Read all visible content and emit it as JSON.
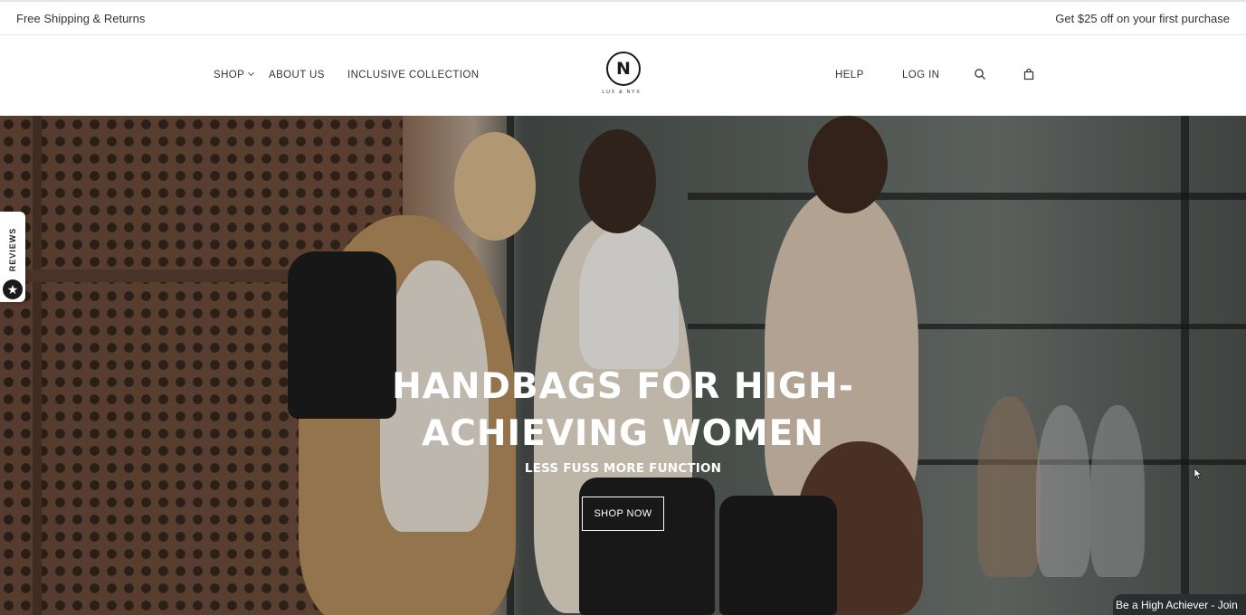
{
  "announcement": {
    "left": "Free Shipping & Returns",
    "right": "Get $25 off on your first purchase"
  },
  "nav": {
    "left_links": [
      "SHOP",
      "ABOUT US",
      "INCLUSIVE COLLECTION"
    ],
    "right_links": [
      "HELP",
      "LOG IN"
    ],
    "logo_mark": "N",
    "logo_text": "LUX & NYX",
    "icons": [
      "search-icon",
      "bag-icon",
      "chevron-down-icon"
    ]
  },
  "hero": {
    "title_line1": "HANDBAGS FOR HIGH-",
    "title_line2": "ACHIEVING WOMEN",
    "subtitle": "LESS FUSS MORE FUNCTION",
    "cta": "SHOP NOW"
  },
  "reviews_tab": {
    "label": "REVIEWS",
    "icon": "star-icon"
  },
  "rewards_badge": {
    "label": "Be a High Achiever - Join"
  },
  "colors": {
    "text": "#222222",
    "hero_text": "#ffffff",
    "badge_bg": "#2a2e2f"
  }
}
